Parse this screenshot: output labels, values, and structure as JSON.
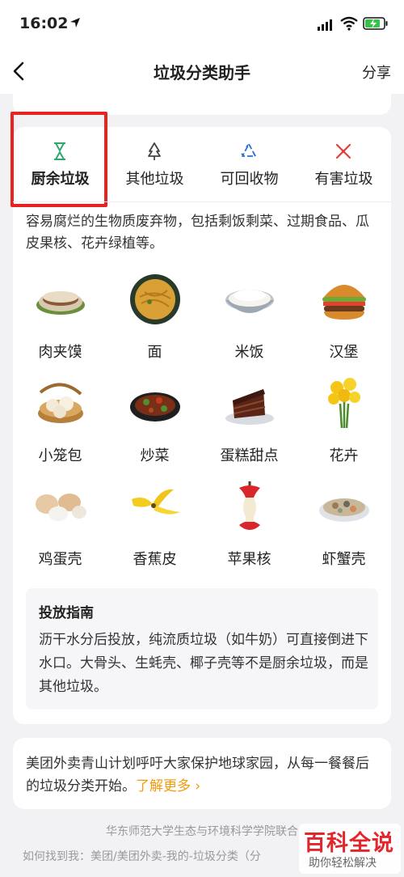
{
  "status": {
    "time": "16:02"
  },
  "nav": {
    "title": "垃圾分类助手",
    "share": "分享"
  },
  "tabs": [
    {
      "label": "厨余垃圾",
      "icon": "hourglass-icon",
      "color": "#2fa86f"
    },
    {
      "label": "其他垃圾",
      "icon": "tree-outline-icon",
      "color": "#444444"
    },
    {
      "label": "可回收物",
      "icon": "recycle-icon",
      "color": "#2f6fd6"
    },
    {
      "label": "有害垃圾",
      "icon": "hazard-x-icon",
      "color": "#e0403a"
    }
  ],
  "description": "容易腐烂的生物质废弃物，包括剩饭剩菜、过期食品、瓜皮果核、花卉绿植等。",
  "items": [
    {
      "label": "肉夹馍"
    },
    {
      "label": "面"
    },
    {
      "label": "米饭"
    },
    {
      "label": "汉堡"
    },
    {
      "label": "小笼包"
    },
    {
      "label": "炒菜"
    },
    {
      "label": "蛋糕甜点"
    },
    {
      "label": "花卉"
    },
    {
      "label": "鸡蛋壳"
    },
    {
      "label": "香蕉皮"
    },
    {
      "label": "苹果核"
    },
    {
      "label": "虾蟹壳"
    }
  ],
  "guide": {
    "title": "投放指南",
    "body": "沥干水分后投放，纯流质垃圾（如牛奶）可直接倒进下水口。大骨头、生蚝壳、椰子壳等不是厨余垃圾，而是其他垃圾。"
  },
  "promo": {
    "text": "美团外卖青山计划呼吁大家保护地球家园，从每一餐餐后的垃圾分类开始。",
    "link": "了解更多 ›"
  },
  "footer": {
    "line1": "华东师范大学生态与环境科学学院联合",
    "line2": "如何找到我：美团/美团外卖-我的-垃圾分类（分"
  },
  "watermark": {
    "main": "百科全说",
    "sub": "助你轻松解决"
  },
  "colors": {
    "accent_link": "#f29a0b",
    "highlight_box": "#e8231f"
  }
}
